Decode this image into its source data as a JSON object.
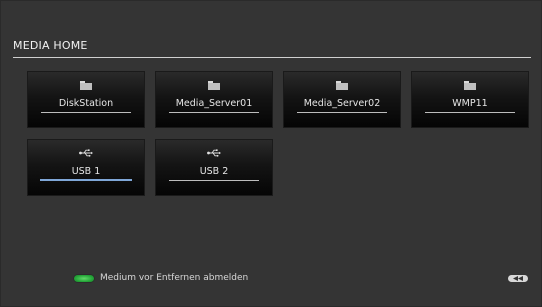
{
  "screen": {
    "title": "MEDIA HOME"
  },
  "tiles": [
    {
      "label": "DiskStation",
      "icon": "folder-icon",
      "selected": false
    },
    {
      "label": "Media_Server01",
      "icon": "folder-icon",
      "selected": false
    },
    {
      "label": "Media_Server02",
      "icon": "folder-icon",
      "selected": false
    },
    {
      "label": "WMP11",
      "icon": "folder-icon",
      "selected": false
    },
    {
      "label": "USB 1",
      "icon": "usb-icon",
      "selected": true
    },
    {
      "label": "USB 2",
      "icon": "usb-icon",
      "selected": false
    }
  ],
  "footer": {
    "hint": "Medium vor Entfernen abmelden",
    "green_button_color": "#2fb045",
    "back_button_icon": "rewind-icon"
  },
  "colors": {
    "background": "#343434",
    "selected_underline": "#7fa7d8"
  }
}
